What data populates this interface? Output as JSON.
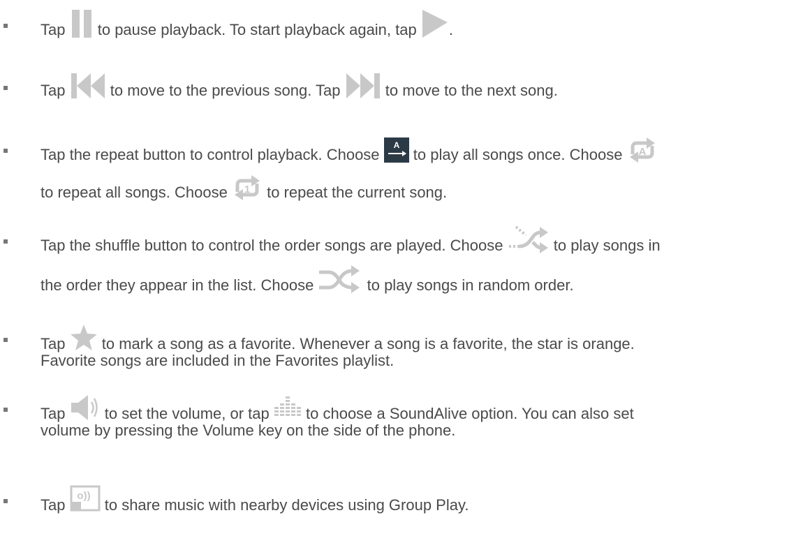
{
  "instructions": [
    {
      "lines": [
        [
          "Tap",
          "to pause playback. To start playback again, tap",
          "."
        ]
      ]
    },
    {
      "lines": [
        [
          "Tap",
          "to move to the previous song. Tap",
          "to move to the next song."
        ]
      ]
    },
    {
      "lines": [
        [
          "Tap the repeat button to control playback. Choose",
          "to play all songs once. Choose"
        ],
        [
          "to repeat all songs. Choose",
          "to repeat the current song."
        ]
      ]
    },
    {
      "lines": [
        [
          "Tap the shuffle button to control the order songs are played. Choose",
          "to play songs in"
        ],
        [
          "the order they appear in the list. Choose",
          "to play songs in random order."
        ]
      ]
    },
    {
      "lines": [
        [
          "Tap",
          "to mark a song as a favorite. Whenever a song is a favorite, the star is orange."
        ],
        [
          "Favorite songs are included in the Favorites playlist."
        ]
      ]
    },
    {
      "lines": [
        [
          "Tap",
          "to set the volume, or tap",
          "to choose a SoundAlive option. You can also set"
        ],
        [
          "volume by pressing the Volume key on the side of the phone."
        ]
      ]
    },
    {
      "lines": [
        [
          "Tap",
          "to share music with nearby devices using Group Play."
        ]
      ]
    }
  ],
  "icons": {
    "repeat_all_glyph": "A",
    "repeat_one_glyph": "1",
    "group_play_glyph": "o))"
  },
  "colors": {
    "text": "#4a4a4a",
    "icon_gray": "#c8c8c8",
    "icon_dark": "#2c3a46",
    "bullet": "#777777"
  }
}
